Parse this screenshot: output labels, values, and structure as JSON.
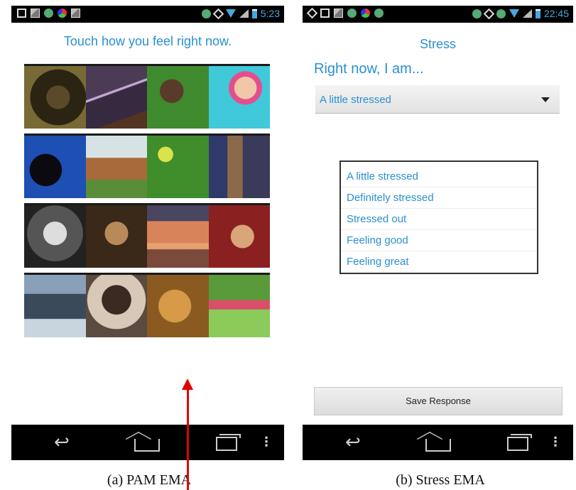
{
  "pam": {
    "status_time": "5:23",
    "prompt": "Touch how you feel right now.",
    "caption": "(a)  PAM EMA",
    "grid_rows": 4,
    "grid_cols": 4
  },
  "stress": {
    "status_time": "22:45",
    "title": "Stress",
    "question": "Right now, I am...",
    "selected": "A little stressed",
    "options": [
      "A little stressed",
      "Definitely stressed",
      "Stressed out",
      "Feeling good",
      "Feeling great"
    ],
    "save_label": "Save Response",
    "caption": "(b)  Stress EMA"
  },
  "icons": {
    "back": "back-icon",
    "home": "home-icon",
    "recents": "recents-icon",
    "menu": "menu-icon"
  },
  "colors": {
    "accent": "#2a8fd1",
    "arrow": "#e00000"
  }
}
